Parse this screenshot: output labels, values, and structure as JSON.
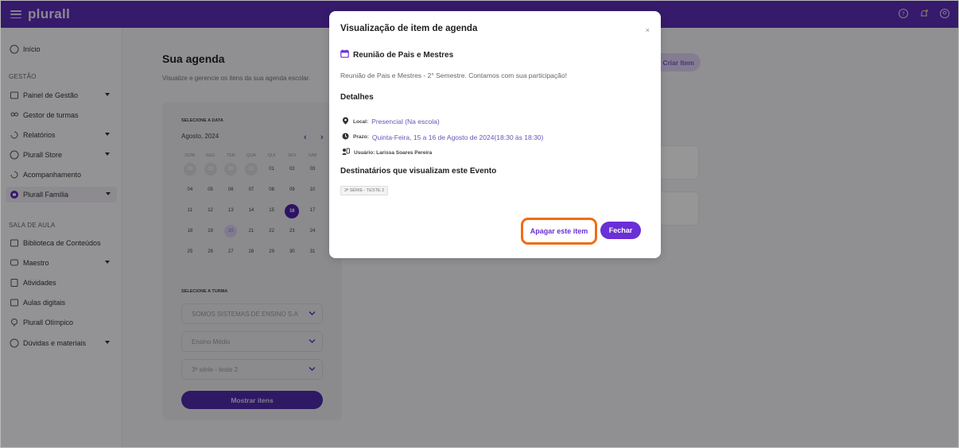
{
  "topbar": {
    "logo": "plurall"
  },
  "sidebar": {
    "items_top": [
      {
        "label": "Início",
        "icon": "home-icon",
        "has_arrow": false
      },
      {
        "label": "Painel de Gestão",
        "icon": "dashboard-icon",
        "has_arrow": true
      },
      {
        "label": "Gestor de turmas",
        "icon": "group-icon",
        "has_arrow": false
      },
      {
        "label": "Relatórios",
        "icon": "report-icon",
        "has_arrow": true
      },
      {
        "label": "Plurall Store",
        "icon": "store-icon",
        "has_arrow": true
      },
      {
        "label": "Acompanhamento",
        "icon": "tracking-icon",
        "has_arrow": false
      },
      {
        "label": "Plurall Família",
        "icon": "family-icon",
        "has_arrow": true
      }
    ],
    "section_gestao": "GESTÃO",
    "section_sala": "SALA DE AULA",
    "items_sala": [
      {
        "label": "Biblioteca de Conteúdos",
        "icon": "library-icon",
        "has_arrow": false
      },
      {
        "label": "Maestro",
        "icon": "maestro-icon",
        "has_arrow": true
      },
      {
        "label": "Atividades",
        "icon": "activities-icon",
        "has_arrow": false
      },
      {
        "label": "Aulas digitais",
        "icon": "digital-class-icon",
        "has_arrow": false
      },
      {
        "label": "Plurall Olímpico",
        "icon": "olympic-icon",
        "has_arrow": false
      },
      {
        "label": "Dúvidas e materiais",
        "icon": "help-icon",
        "has_arrow": true
      }
    ]
  },
  "main": {
    "title": "Sua agenda",
    "subtitle": "Visualize e gerencie os itens da sua agenda escolar.",
    "criar_label": "Criar Item",
    "calendar": {
      "select_date_label": "SELECIONE A DATA",
      "month": "Agosto, 2024",
      "prev": "‹",
      "next": "›",
      "weekdays": [
        "DOM",
        "SEG",
        "TER",
        "QUA",
        "QUI",
        "SEX",
        "SAB"
      ],
      "weeks": [
        [
          "28",
          "29",
          "30",
          "31",
          "01",
          "02",
          "03"
        ],
        [
          "04",
          "05",
          "06",
          "07",
          "08",
          "09",
          "10"
        ],
        [
          "11",
          "12",
          "13",
          "14",
          "15",
          "16",
          "17"
        ],
        [
          "18",
          "19",
          "20",
          "21",
          "22",
          "23",
          "24"
        ],
        [
          "25",
          "26",
          "27",
          "28",
          "29",
          "30",
          "31"
        ]
      ],
      "selected_day": "16",
      "today_day": "20",
      "select_class_label": "SELECIONE A TURMA",
      "select_1": "SOMOS SISTEMAS DE ENSINO S.A",
      "select_2": "Ensino Médio",
      "select_3": "3ª série - teste 2",
      "mostrar_label": "Mostrar itens"
    }
  },
  "modal": {
    "title": "Visualização de item de agenda",
    "close": "×",
    "event_title": "Reunião de Pais e Mestres",
    "event_desc": "Reunião de Pais e Mestres - 2° Semestre. Contamos com sua participação!",
    "details_heading": "Detalhes",
    "local_label": "Local:",
    "local_value": "Presencial (Na escola)",
    "prazo_label": "Prazo:",
    "prazo_value": "Quinta-Feira, 15 a 16 de Agosto de 2024(18:30 às 18:30)",
    "usuario_label": "Usuário: Larissa Soares Pereira",
    "recipients_heading": "Destinatários que visualizam este Evento",
    "recipient_chip": "3ª SÉRIE - TESTE 2",
    "delete_label": "Apagar este item",
    "close_label": "Fechar"
  },
  "colors": {
    "brand": "#5b2cb3",
    "accent": "#6a2fd6",
    "highlight": "#f26b16"
  }
}
